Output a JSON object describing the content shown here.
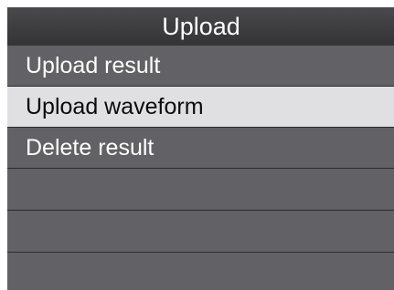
{
  "header": {
    "title": "Upload"
  },
  "menu": {
    "items": [
      {
        "label": "Upload result",
        "selected": false
      },
      {
        "label": "Upload waveform",
        "selected": true
      },
      {
        "label": "Delete result",
        "selected": false
      },
      {
        "label": "",
        "selected": false
      },
      {
        "label": "",
        "selected": false
      },
      {
        "label": "",
        "selected": false
      }
    ]
  },
  "colors": {
    "background": "#626266",
    "header": "#3d3d40",
    "selected_row": "#e0e0e2",
    "text": "#ffffff",
    "selected_text": "#0a0a0a",
    "divider": "#2a2a2d"
  }
}
